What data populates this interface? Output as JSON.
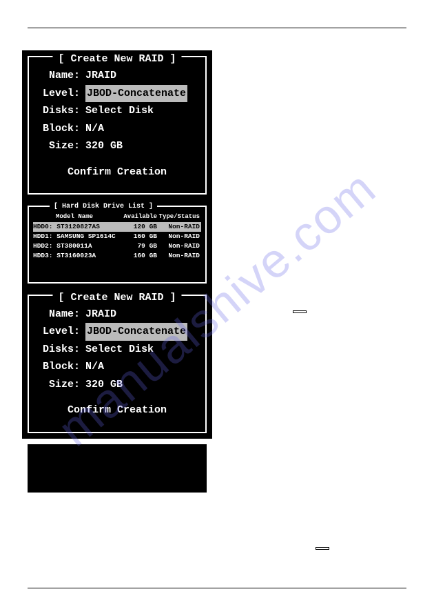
{
  "watermark": "manualshive.com",
  "panel1": {
    "title": "[ Create New RAID ]",
    "nameLabel": "Name:",
    "nameVal": "JRAID",
    "levelLabel": "Level:",
    "levelVal": "JBOD-Concatenate",
    "disksLabel": "Disks:",
    "disksVal": "Select Disk",
    "blockLabel": "Block:",
    "blockVal": "N/A",
    "sizeLabel": "Size:",
    "sizeVal": " 320 GB",
    "confirm": "Confirm Creation"
  },
  "hdd": {
    "title": "[ Hard Disk Drive List ]",
    "h1": "Model Name",
    "h2": "Available",
    "h3": "Type/Status",
    "rows": [
      {
        "c1": "HDD0: ST3120827AS",
        "c2": "120 GB",
        "c3": "Non-RAID",
        "sel": true
      },
      {
        "c1": "HDD1: SAMSUNG SP1614C",
        "c2": "160 GB",
        "c3": "Non-RAID",
        "sel": false
      },
      {
        "c1": "HDD2: ST380011A",
        "c2": "79 GB",
        "c3": "Non-RAID",
        "sel": false
      },
      {
        "c1": "HDD3: ST3160023A",
        "c2": "160 GB",
        "c3": "Non-RAID",
        "sel": false
      }
    ]
  },
  "panel2": {
    "title": "[ Create New RAID ]",
    "nameLabel": "Name:",
    "nameVal": "JRAID",
    "levelLabel": "Level:",
    "levelVal": "JBOD-Concatenate",
    "disksLabel": "Disks:",
    "disksVal": "Select Disk",
    "blockLabel": "Block:",
    "blockVal": "N/A",
    "sizeLabel": "Size:",
    "sizeVal": " 320 GB",
    "confirm": "Confirm Creation"
  },
  "keys": {
    "k1": " ",
    "k2": " "
  }
}
